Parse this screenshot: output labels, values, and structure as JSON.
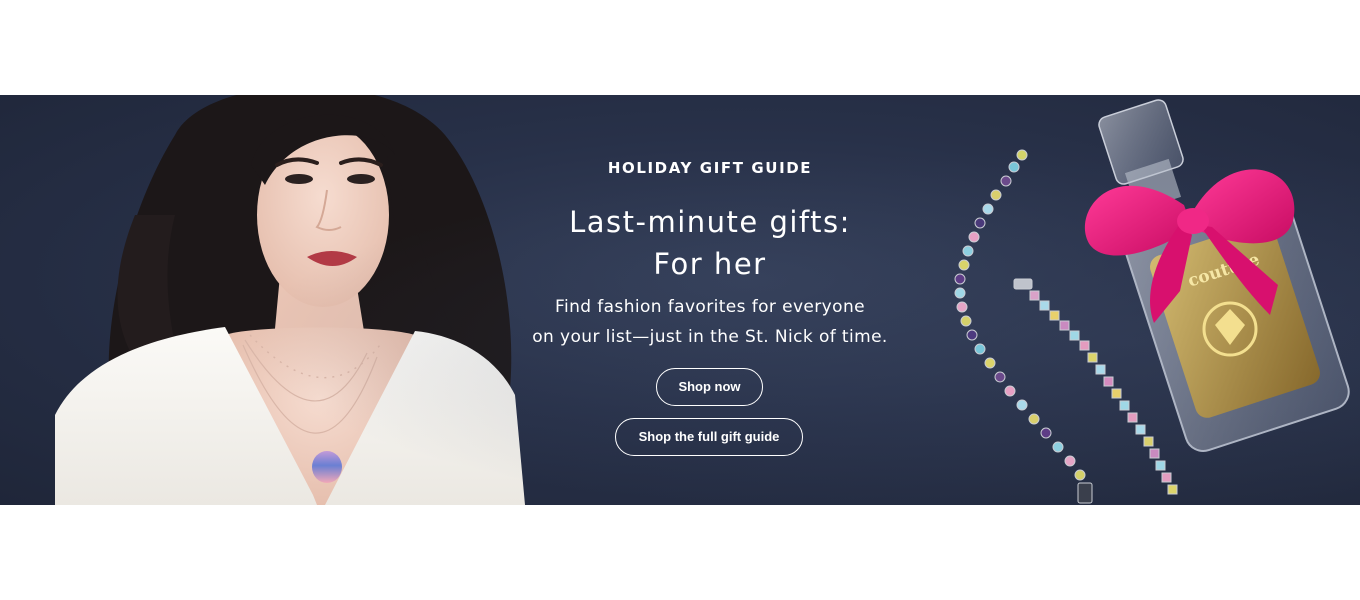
{
  "banner": {
    "eyebrow": "HOLIDAY GIFT GUIDE",
    "headline": [
      "Last-minute gifts:",
      "For her"
    ],
    "subcopy": [
      "Find fashion favorites for everyone",
      "on your list—just in the St. Nick of time."
    ],
    "buttons": {
      "shop_now": "Shop now",
      "full_guide": "Shop the full gift guide"
    },
    "images": {
      "model": "woman-with-necklaces-photo",
      "products": "bracelets-and-perfume-photo",
      "perfume_label": "couture"
    },
    "colors": {
      "background": "#283149",
      "text": "#ffffff",
      "bow": "#e8177a"
    }
  }
}
